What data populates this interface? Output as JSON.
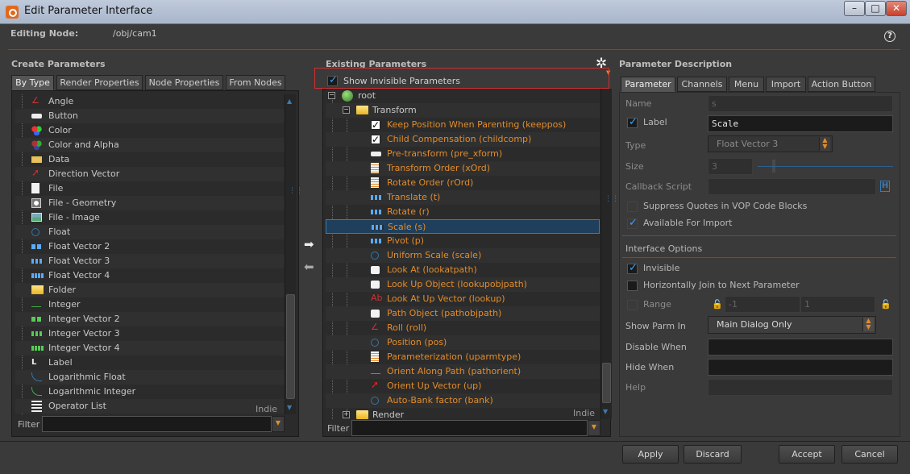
{
  "window": {
    "title": "Edit Parameter Interface",
    "btn_min": "–",
    "btn_max": "□",
    "btn_close": "✕"
  },
  "header": {
    "editing_label": "Editing Node:",
    "editing_value": "/obj/cam1",
    "help": "?"
  },
  "create": {
    "title": "Create Parameters",
    "tabs": [
      "By Type",
      "Render Properties",
      "Node Properties",
      "From Nodes"
    ],
    "items": [
      {
        "label": "Angle",
        "icon": "angle-icon"
      },
      {
        "label": "Button",
        "icon": "button-icon"
      },
      {
        "label": "Color",
        "icon": "color-icon"
      },
      {
        "label": "Color and Alpha",
        "icon": "color-alpha-icon"
      },
      {
        "label": "Data",
        "icon": "data-icon"
      },
      {
        "label": "Direction Vector",
        "icon": "direction-vector-icon"
      },
      {
        "label": "File",
        "icon": "file-icon"
      },
      {
        "label": "File - Geometry",
        "icon": "file-geometry-icon"
      },
      {
        "label": "File - Image",
        "icon": "file-image-icon"
      },
      {
        "label": "Float",
        "icon": "float-icon"
      },
      {
        "label": "Float Vector 2",
        "icon": "float-vector2-icon"
      },
      {
        "label": "Float Vector 3",
        "icon": "float-vector3-icon"
      },
      {
        "label": "Float Vector 4",
        "icon": "float-vector4-icon"
      },
      {
        "label": "Folder",
        "icon": "folder-icon"
      },
      {
        "label": "Integer",
        "icon": "integer-icon"
      },
      {
        "label": "Integer Vector 2",
        "icon": "integer-vector2-icon"
      },
      {
        "label": "Integer Vector 3",
        "icon": "integer-vector3-icon"
      },
      {
        "label": "Integer Vector 4",
        "icon": "integer-vector4-icon"
      },
      {
        "label": "Label",
        "icon": "label-icon"
      },
      {
        "label": "Logarithmic Float",
        "icon": "log-float-icon"
      },
      {
        "label": "Logarithmic Integer",
        "icon": "log-integer-icon"
      },
      {
        "label": "Operator List",
        "icon": "operator-list-icon"
      }
    ],
    "watermark": "Indie",
    "filter_label": "Filter"
  },
  "existing": {
    "title": "Existing Parameters",
    "show_invisible": "Show Invisible Parameters",
    "root": "root",
    "transform": "Transform",
    "items": [
      {
        "label": "Keep Position When Parenting (keeppos)",
        "icon": "toggle-icon"
      },
      {
        "label": "Child Compensation (childcomp)",
        "icon": "toggle-icon"
      },
      {
        "label": "Pre-transform (pre_xform)",
        "icon": "button-icon"
      },
      {
        "label": "Transform Order (xOrd)",
        "icon": "menu-icon"
      },
      {
        "label": "Rotate Order (rOrd)",
        "icon": "menu-icon"
      },
      {
        "label": "Translate (t)",
        "icon": "float-vector3-icon"
      },
      {
        "label": "Rotate (r)",
        "icon": "float-vector3-icon"
      },
      {
        "label": "Scale (s)",
        "icon": "float-vector3-icon"
      },
      {
        "label": "Pivot (p)",
        "icon": "float-vector3-icon"
      },
      {
        "label": "Uniform Scale (scale)",
        "icon": "float-icon"
      },
      {
        "label": "Look At (lookatpath)",
        "icon": "operator-path-icon"
      },
      {
        "label": "Look Up Object (lookupobjpath)",
        "icon": "operator-path-icon"
      },
      {
        "label": "Look At Up Vector (lookup)",
        "icon": "string-icon"
      },
      {
        "label": "Path Object (pathobjpath)",
        "icon": "operator-path-icon"
      },
      {
        "label": "Roll (roll)",
        "icon": "angle-icon"
      },
      {
        "label": "Position (pos)",
        "icon": "float-icon"
      },
      {
        "label": "Parameterization (uparmtype)",
        "icon": "menu-icon"
      },
      {
        "label": "Orient Along Path (pathorient)",
        "icon": "integer-icon"
      },
      {
        "label": "Orient Up Vector (up)",
        "icon": "direction-vector-icon"
      },
      {
        "label": "Auto-Bank factor (bank)",
        "icon": "float-icon"
      }
    ],
    "render": "Render",
    "watermark": "Indie",
    "filter_label": "Filter"
  },
  "description": {
    "title": "Parameter Description",
    "tabs": [
      "Parameter",
      "Channels",
      "Menu",
      "Import",
      "Action Button"
    ],
    "name_label": "Name",
    "name_value": "s",
    "label_label": "Label",
    "label_value": "Scale",
    "type_label": "Type",
    "type_value": "Float Vector 3",
    "size_label": "Size",
    "size_value": "3",
    "callback_label": "Callback Script",
    "callback_h": "H",
    "suppress_quotes": "Suppress Quotes in VOP Code Blocks",
    "available_import": "Available For Import",
    "interface_options": "Interface Options",
    "invisible": "Invisible",
    "horiz_join": "Horizontally Join to Next Parameter",
    "range_label": "Range",
    "range_min": "-1",
    "range_max": "1",
    "show_parm_in_label": "Show Parm In",
    "show_parm_in_value": "Main Dialog Only",
    "disable_when": "Disable When",
    "hide_when": "Hide When",
    "help_label": "Help"
  },
  "footer": {
    "apply": "Apply",
    "discard": "Discard",
    "accept": "Accept",
    "cancel": "Cancel"
  },
  "colors": {
    "accent_orange": "#e28c2b",
    "selection": "#1f3f5c",
    "highlight_border": "#d03030",
    "separator": "#2e5f8c"
  }
}
